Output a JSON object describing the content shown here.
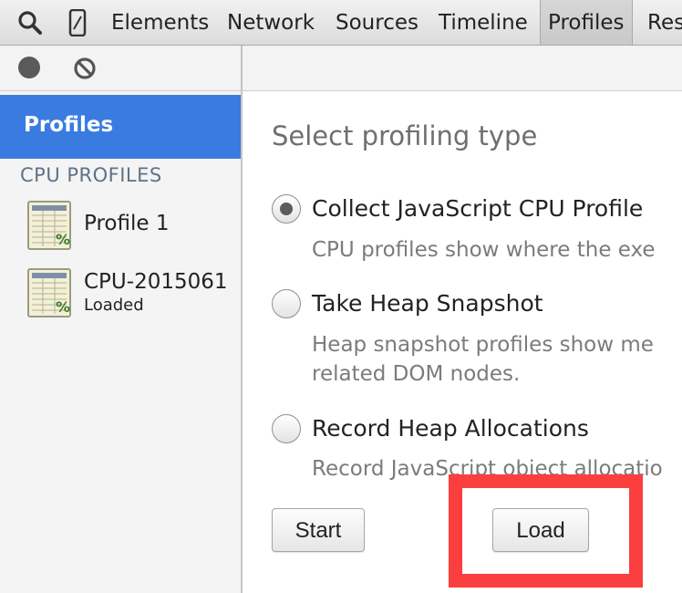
{
  "tabs": [
    "Elements",
    "Network",
    "Sources",
    "Timeline",
    "Profiles",
    "Res"
  ],
  "selected_tab": "Profiles",
  "toolbar": {
    "record_icon": "record-icon",
    "clear_icon": "clear-icon",
    "search_icon": "search-icon",
    "device_icon": "device-mode-icon"
  },
  "sidebar": {
    "selected_label": "Profiles",
    "section_header": "CPU PROFILES",
    "items": [
      {
        "title": "Profile 1",
        "subtitle": ""
      },
      {
        "title": "CPU-2015061",
        "subtitle": "Loaded"
      }
    ]
  },
  "main": {
    "title": "Select profiling type",
    "options": [
      {
        "label": "Collect JavaScript CPU Profile",
        "desc": "CPU profiles show where the exe",
        "checked": true
      },
      {
        "label": "Take Heap Snapshot",
        "desc": "Heap snapshot profiles show me",
        "desc2": "related DOM nodes.",
        "checked": false
      },
      {
        "label": "Record Heap Allocations",
        "desc": "Record JavaScript object allocatio",
        "checked": false
      }
    ],
    "start_label": "Start",
    "load_label": "Load"
  },
  "colors": {
    "selection": "#3a7bdf",
    "highlight": "#fb3f3f"
  }
}
